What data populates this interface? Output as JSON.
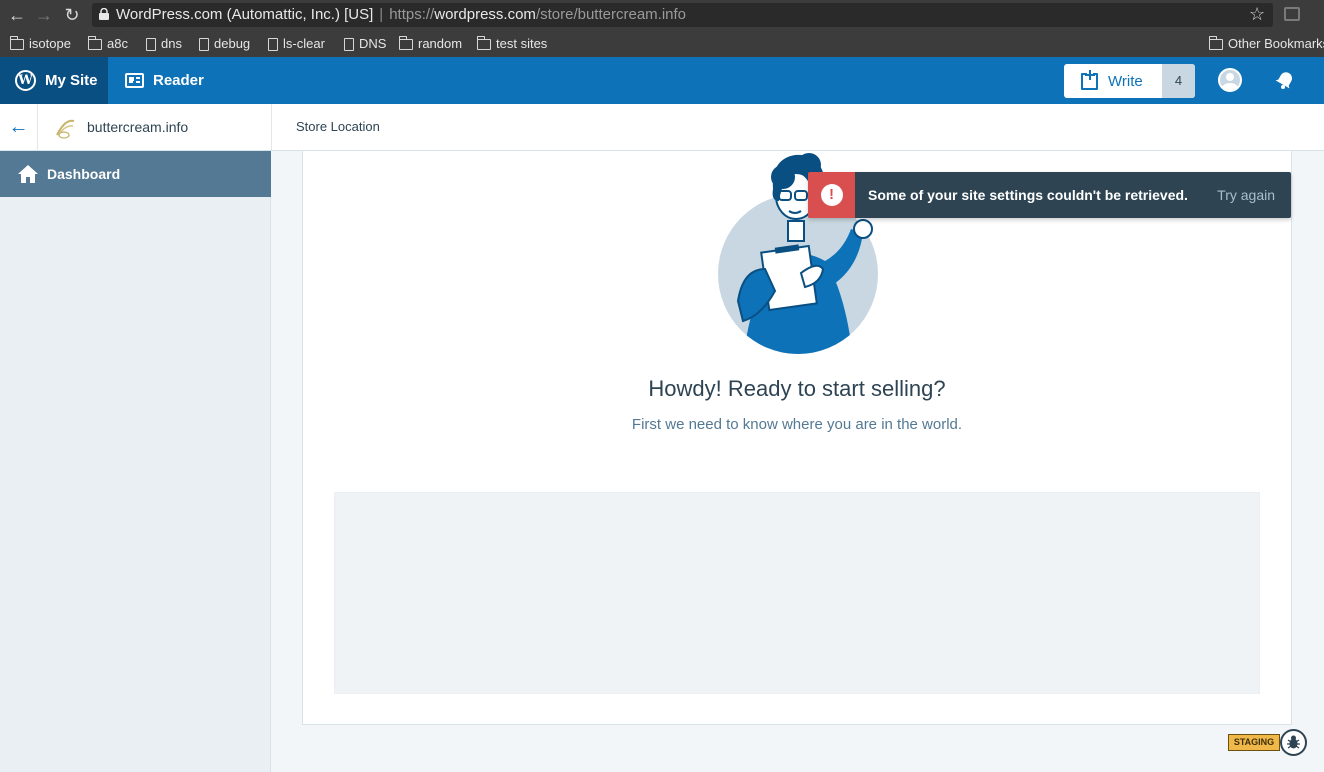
{
  "browser": {
    "url_site_label": "WordPress.com (Automattic, Inc.) [US]",
    "url_prefix": "https://",
    "url_domain": "wordpress.com",
    "url_path": "/store/buttercream.info",
    "bookmarks": [
      {
        "label": "isotope",
        "type": "folder"
      },
      {
        "label": "a8c",
        "type": "folder"
      },
      {
        "label": "dns",
        "type": "page"
      },
      {
        "label": "debug",
        "type": "page"
      },
      {
        "label": "ls-clear",
        "type": "page"
      },
      {
        "label": "DNS",
        "type": "page"
      },
      {
        "label": "random",
        "type": "folder"
      },
      {
        "label": "test sites",
        "type": "folder"
      }
    ],
    "other_bookmarks": "Other Bookmarks"
  },
  "masterbar": {
    "my_site": "My Site",
    "reader": "Reader",
    "write": "Write",
    "drafts_count": "4",
    "colors": {
      "bar": "#0d72b8",
      "active": "#0a4f82"
    }
  },
  "subbar": {
    "site_name": "buttercream.info",
    "page_title": "Store Location"
  },
  "sidebar": {
    "dashboard": "Dashboard"
  },
  "main": {
    "heading": "Howdy! Ready to start selling?",
    "subheading": "First we need to know where you are in the world."
  },
  "notice": {
    "message": "Some of your site settings couldn't be retrieved.",
    "action": "Try again",
    "icon_glyph": "!",
    "color": "#d94f4f"
  },
  "staging": {
    "label": "STAGING"
  }
}
